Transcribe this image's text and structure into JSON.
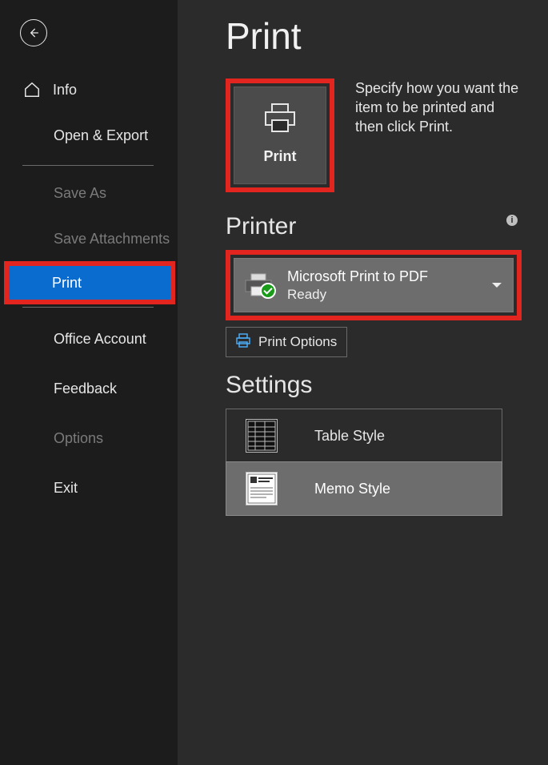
{
  "sidebar": {
    "info": "Info",
    "open_export": "Open & Export",
    "save_as": "Save As",
    "save_attachments": "Save Attachments",
    "print": "Print",
    "office_account": "Office Account",
    "feedback": "Feedback",
    "options": "Options",
    "exit": "Exit"
  },
  "page": {
    "title": "Print",
    "print_tile_label": "Print",
    "print_desc": "Specify how you want the item to be printed and then click Print."
  },
  "printer": {
    "header": "Printer",
    "name": "Microsoft Print to PDF",
    "status": "Ready",
    "options_label": "Print Options"
  },
  "settings": {
    "header": "Settings",
    "table_style": "Table Style",
    "memo_style": "Memo Style"
  }
}
